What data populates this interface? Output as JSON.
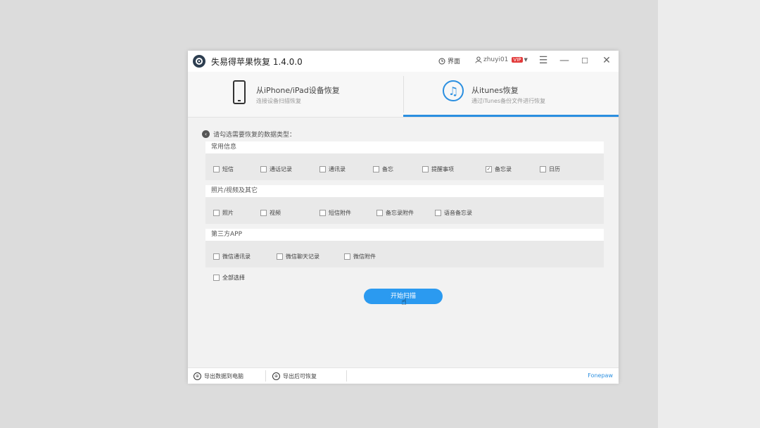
{
  "app": {
    "title": "失易得苹果恢复  1.4.0.0",
    "open_label": "界面",
    "user_label": "zhuyi01",
    "vip_label": "VIP",
    "controls": [
      "☰",
      "—",
      "☐",
      "✕"
    ]
  },
  "tabs": [
    {
      "title": "从iPhone/iPad设备恢复",
      "subtitle": "连接设备扫描恢复"
    },
    {
      "title": "从itunes恢复",
      "subtitle": "通过iTunes备份文件进行恢复"
    }
  ],
  "hint": "请勾选需要恢复的数据类型：",
  "sections": [
    {
      "title": "常用信息",
      "items": [
        {
          "label": "短信",
          "checked": false
        },
        {
          "label": "通话记录",
          "checked": false
        },
        {
          "label": "通讯录",
          "checked": false
        },
        {
          "label": "备忘",
          "checked": false
        },
        {
          "label": "提醒事项",
          "checked": false
        },
        {
          "label": "备忘录",
          "checked": true
        },
        {
          "label": "日历",
          "checked": false
        }
      ]
    },
    {
      "title": "照片/视频及其它",
      "items": [
        {
          "label": "照片",
          "checked": false
        },
        {
          "label": "视频",
          "checked": false
        },
        {
          "label": "短信附件",
          "checked": false
        },
        {
          "label": "备忘录附件",
          "checked": false
        },
        {
          "label": "语音备忘录",
          "checked": false
        }
      ]
    },
    {
      "title": "第三方APP",
      "items": [
        {
          "label": "微信通讯录",
          "checked": false
        },
        {
          "label": "微信聊天记录",
          "checked": false
        },
        {
          "label": "微信附件",
          "checked": false
        }
      ]
    }
  ],
  "select_all": "全部选择",
  "scan_button": "开始扫描",
  "footer": {
    "left1": "导出数据到电脑",
    "left2": "导出后可恢复",
    "right": "Fonepaw"
  }
}
